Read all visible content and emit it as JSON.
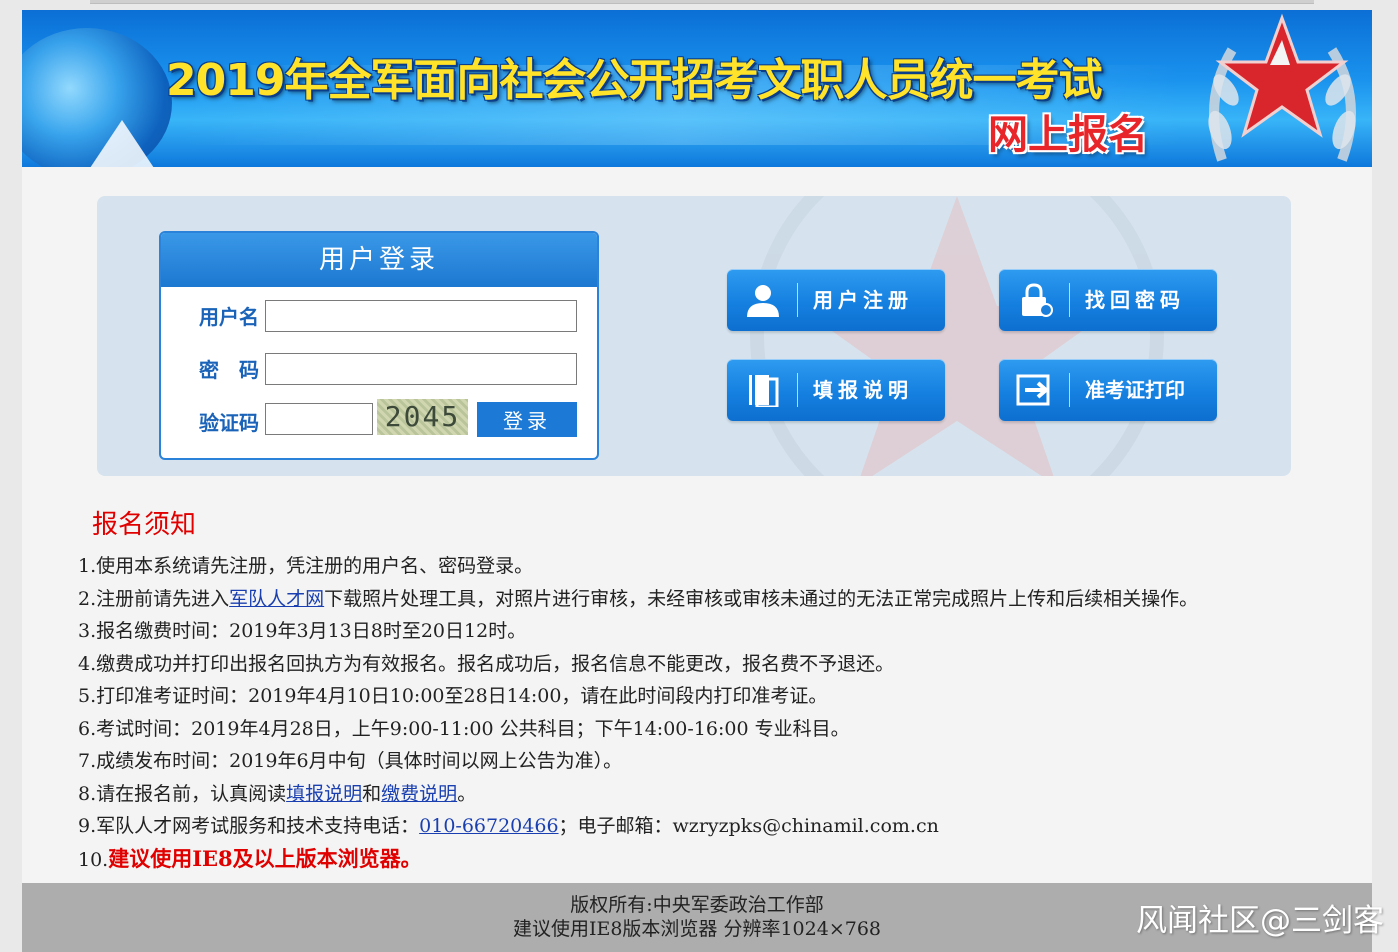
{
  "banner": {
    "title": "2019年全军面向社会公开招考文职人员统一考试",
    "subtitle": "网上报名"
  },
  "login": {
    "heading": "用户登录",
    "username_label": "用户名",
    "password_label": "密　码",
    "captcha_label": "验证码",
    "captcha_value": "2045",
    "submit_label": "登录"
  },
  "actions": {
    "register": {
      "label": "用户注册",
      "icon": "user-icon"
    },
    "recover": {
      "label": "找回密码",
      "icon": "lock-icon"
    },
    "instructions": {
      "label": "填报说明",
      "icon": "book-icon"
    },
    "admission": {
      "label": "准考证打印",
      "icon": "exit-arrow-icon"
    }
  },
  "notice": {
    "title": "报名须知",
    "items": {
      "n1": "1.使用本系统请先注册，凭注册的用户名、密码登录。",
      "n2_pre": "2.注册前请先进入",
      "n2_link": "军队人才网",
      "n2_post": "下载照片处理工具，对照片进行审核，未经审核或审核未通过的无法正常完成照片上传和后续相关操作。",
      "n3": "3.报名缴费时间：2019年3月13日8时至20日12时。",
      "n4": "4.缴费成功并打印出报名回执方为有效报名。报名成功后，报名信息不能更改，报名费不予退还。",
      "n5": "5.打印准考证时间：2019年4月10日10:00至28日14:00，请在此时间段内打印准考证。",
      "n6": "6.考试时间：2019年4月28日，上午9:00-11:00 公共科目；下午14:00-16:00 专业科目。",
      "n7": "7.成绩发布时间：2019年6月中旬（具体时间以网上公告为准）。",
      "n8_pre": "8.请在报名前，认真阅读",
      "n8_link1": "填报说明",
      "n8_mid": "和",
      "n8_link2": "缴费说明",
      "n8_post": "。",
      "n9_pre": "9.军队人才网考试服务和技术支持电话：",
      "n9_phone": "010-66720466",
      "n9_post": "；电子邮箱：wzryzpks@chinamil.com.cn",
      "n10_num": "10.",
      "n10_text": "建议使用IE8及以上版本浏览器。"
    }
  },
  "footer": {
    "line1": "版权所有:中央军委政治工作部",
    "line2": "建议使用IE8版本浏览器 分辨率1024×768"
  },
  "overlay_watermark": "风闻社区@三剑客",
  "colors": {
    "banner_blue": "#1a93ee",
    "title_yellow": "#ffe22a",
    "accent_red": "#e00000",
    "button_blue": "#1c7ad6",
    "label_blue": "#1a63b8"
  }
}
